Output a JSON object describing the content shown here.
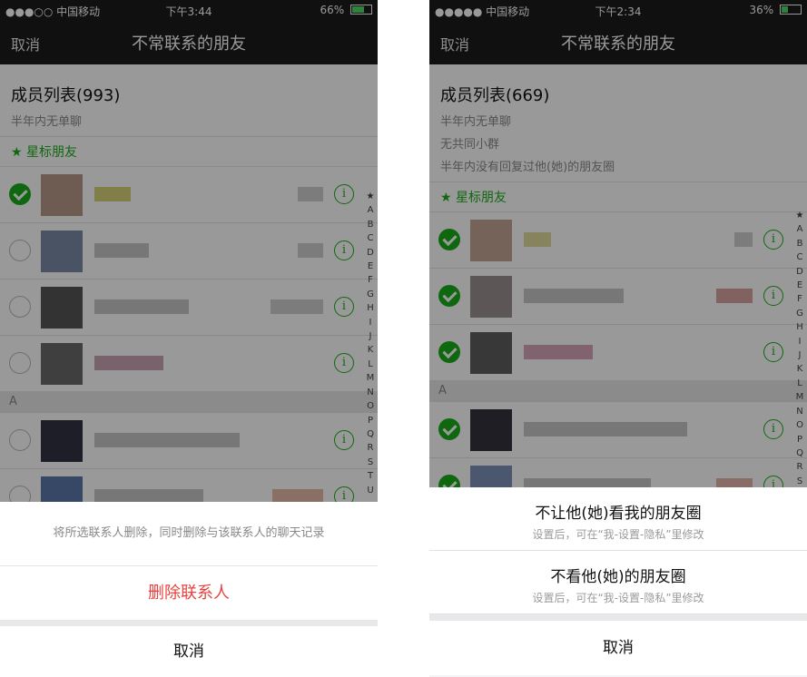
{
  "left": {
    "status": {
      "carrier": "●●●○○ 中国移动",
      "time": "下午3:44",
      "battery": "66%",
      "battery_level": 0.66
    },
    "nav": {
      "cancel": "取消",
      "title": "不常联系的朋友"
    },
    "members_title": "成员列表(993)",
    "conditions": [
      "半年内无单聊"
    ],
    "starred_label": "★ 星标朋友",
    "section_a": "A",
    "index": [
      "★",
      "A",
      "B",
      "C",
      "D",
      "E",
      "F",
      "G",
      "H",
      "I",
      "J",
      "K",
      "L",
      "M",
      "N",
      "O",
      "P",
      "Q",
      "R",
      "S",
      "T",
      "U"
    ],
    "sheet": {
      "tip": "将所选联系人删除，同时删除与该联系人的聊天记录",
      "action": "删除联系人",
      "cancel": "取消"
    }
  },
  "right": {
    "status": {
      "carrier": "●●●●● 中国移动",
      "time": "下午2:34",
      "battery": "36%",
      "battery_level": 0.36
    },
    "nav": {
      "cancel": "取消",
      "title": "不常联系的朋友"
    },
    "members_title": "成员列表(669)",
    "conditions": [
      "半年内无单聊",
      "无共同小群",
      "半年内没有回复过他(她)的朋友圈"
    ],
    "starred_label": "★ 星标朋友",
    "section_a": "A",
    "index": [
      "★",
      "A",
      "B",
      "C",
      "D",
      "E",
      "F",
      "G",
      "H",
      "I",
      "J",
      "K",
      "L",
      "M",
      "N",
      "O",
      "P",
      "Q",
      "R",
      "S"
    ],
    "sheet": {
      "option1": {
        "title": "不让他(她)看我的朋友圈",
        "sub": "设置后，可在“我-设置-隐私”里修改"
      },
      "option2": {
        "title": "不看他(她)的朋友圈",
        "sub": "设置后，可在“我-设置-隐私”里修改"
      },
      "cancel": "取消"
    }
  },
  "icons": {
    "info": "info-circle-icon",
    "check": "check-circle-icon",
    "star": "star-icon"
  },
  "colors": {
    "accent_green": "#1aad19",
    "danger_red": "#e64340",
    "navbar": "#1b1b1d"
  }
}
